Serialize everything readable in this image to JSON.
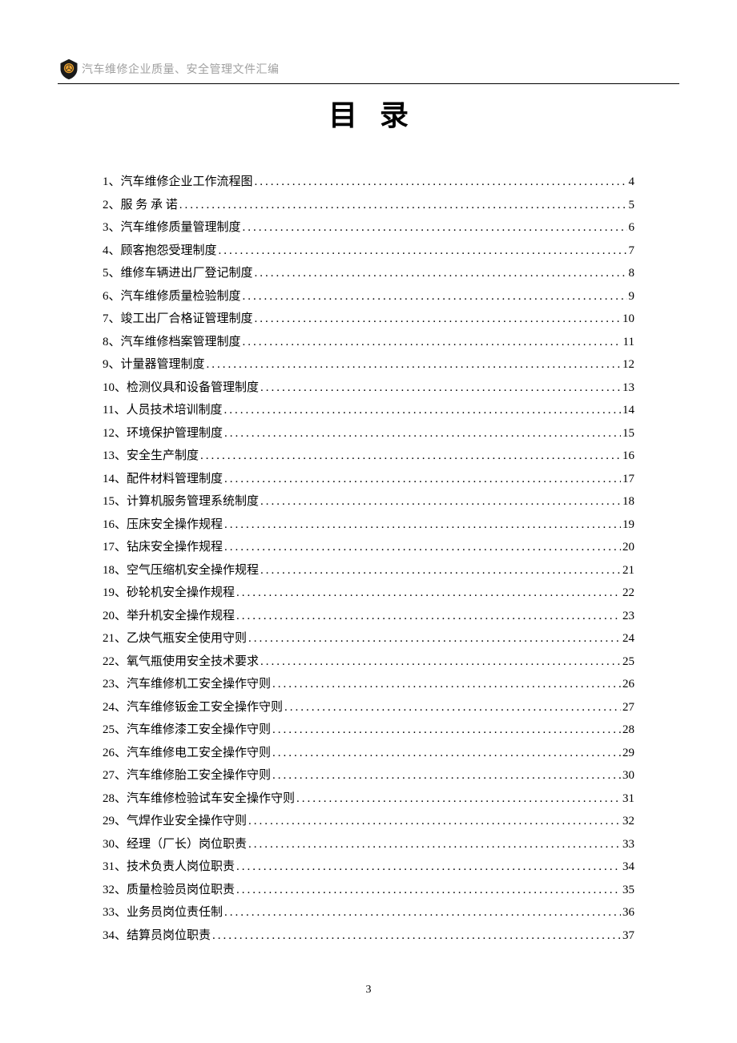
{
  "header": {
    "text": "汽车维修企业质量、安全管理文件汇编"
  },
  "title": "目录",
  "toc": [
    {
      "num": "1、",
      "label": "汽车维修企业工作流程图",
      "page": "4"
    },
    {
      "num": "2、",
      "label": "服 务 承 诺",
      "page": "5"
    },
    {
      "num": "3、",
      "label": "汽车维修质量管理制度",
      "page": "6"
    },
    {
      "num": "4、",
      "label": "顾客抱怨受理制度",
      "page": "7"
    },
    {
      "num": "5、",
      "label": "维修车辆进出厂登记制度",
      "page": "8"
    },
    {
      "num": "6、",
      "label": "汽车维修质量检验制度",
      "page": "9"
    },
    {
      "num": "7、",
      "label": "竣工出厂合格证管理制度",
      "page": "10"
    },
    {
      "num": "8、",
      "label": "汽车维修档案管理制度",
      "page": "11"
    },
    {
      "num": "9、",
      "label": "计量器管理制度",
      "page": "12"
    },
    {
      "num": "10、",
      "label": "检测仪具和设备管理制度",
      "page": "13"
    },
    {
      "num": "11、",
      "label": "人员技术培训制度",
      "page": "14"
    },
    {
      "num": "12、",
      "label": "环境保护管理制度",
      "page": "15"
    },
    {
      "num": "13、",
      "label": "安全生产制度",
      "page": "16"
    },
    {
      "num": "14、",
      "label": "配件材料管理制度",
      "page": "17"
    },
    {
      "num": "15、",
      "label": "计算机服务管理系统制度",
      "page": "18"
    },
    {
      "num": "16、",
      "label": "压床安全操作规程",
      "page": "19"
    },
    {
      "num": "17、",
      "label": "钻床安全操作规程",
      "page": "20"
    },
    {
      "num": "18、",
      "label": "空气压缩机安全操作规程",
      "page": "21"
    },
    {
      "num": "19、",
      "label": "砂轮机安全操作规程",
      "page": "22"
    },
    {
      "num": "20、",
      "label": "举升机安全操作规程",
      "page": "23"
    },
    {
      "num": "21、",
      "label": "乙炔气瓶安全使用守则",
      "page": "24"
    },
    {
      "num": "22、",
      "label": "氧气瓶使用安全技术要求",
      "page": "25"
    },
    {
      "num": "23、",
      "label": "汽车维修机工安全操作守则",
      "page": "26"
    },
    {
      "num": "24、",
      "label": "汽车维修钣金工安全操作守则",
      "page": "27"
    },
    {
      "num": "25、",
      "label": "汽车维修漆工安全操作守则",
      "page": "28"
    },
    {
      "num": "26、",
      "label": "汽车维修电工安全操作守则",
      "page": "29"
    },
    {
      "num": "27、",
      "label": "汽车维修胎工安全操作守则",
      "page": "30"
    },
    {
      "num": "28、",
      "label": "汽车维修检验试车安全操作守则",
      "page": "31"
    },
    {
      "num": "29、",
      "label": "气焊作业安全操作守则",
      "page": "32"
    },
    {
      "num": "30、",
      "label": "经理（厂长）岗位职责",
      "page": "33"
    },
    {
      "num": "31、",
      "label": "技术负责人岗位职责",
      "page": "34"
    },
    {
      "num": "32、",
      "label": "质量检验员岗位职责",
      "page": "35"
    },
    {
      "num": "33、",
      "label": "业务员岗位责任制",
      "page": "36"
    },
    {
      "num": "34、",
      "label": "结算员岗位职责",
      "page": "37"
    }
  ],
  "page_number": "3"
}
